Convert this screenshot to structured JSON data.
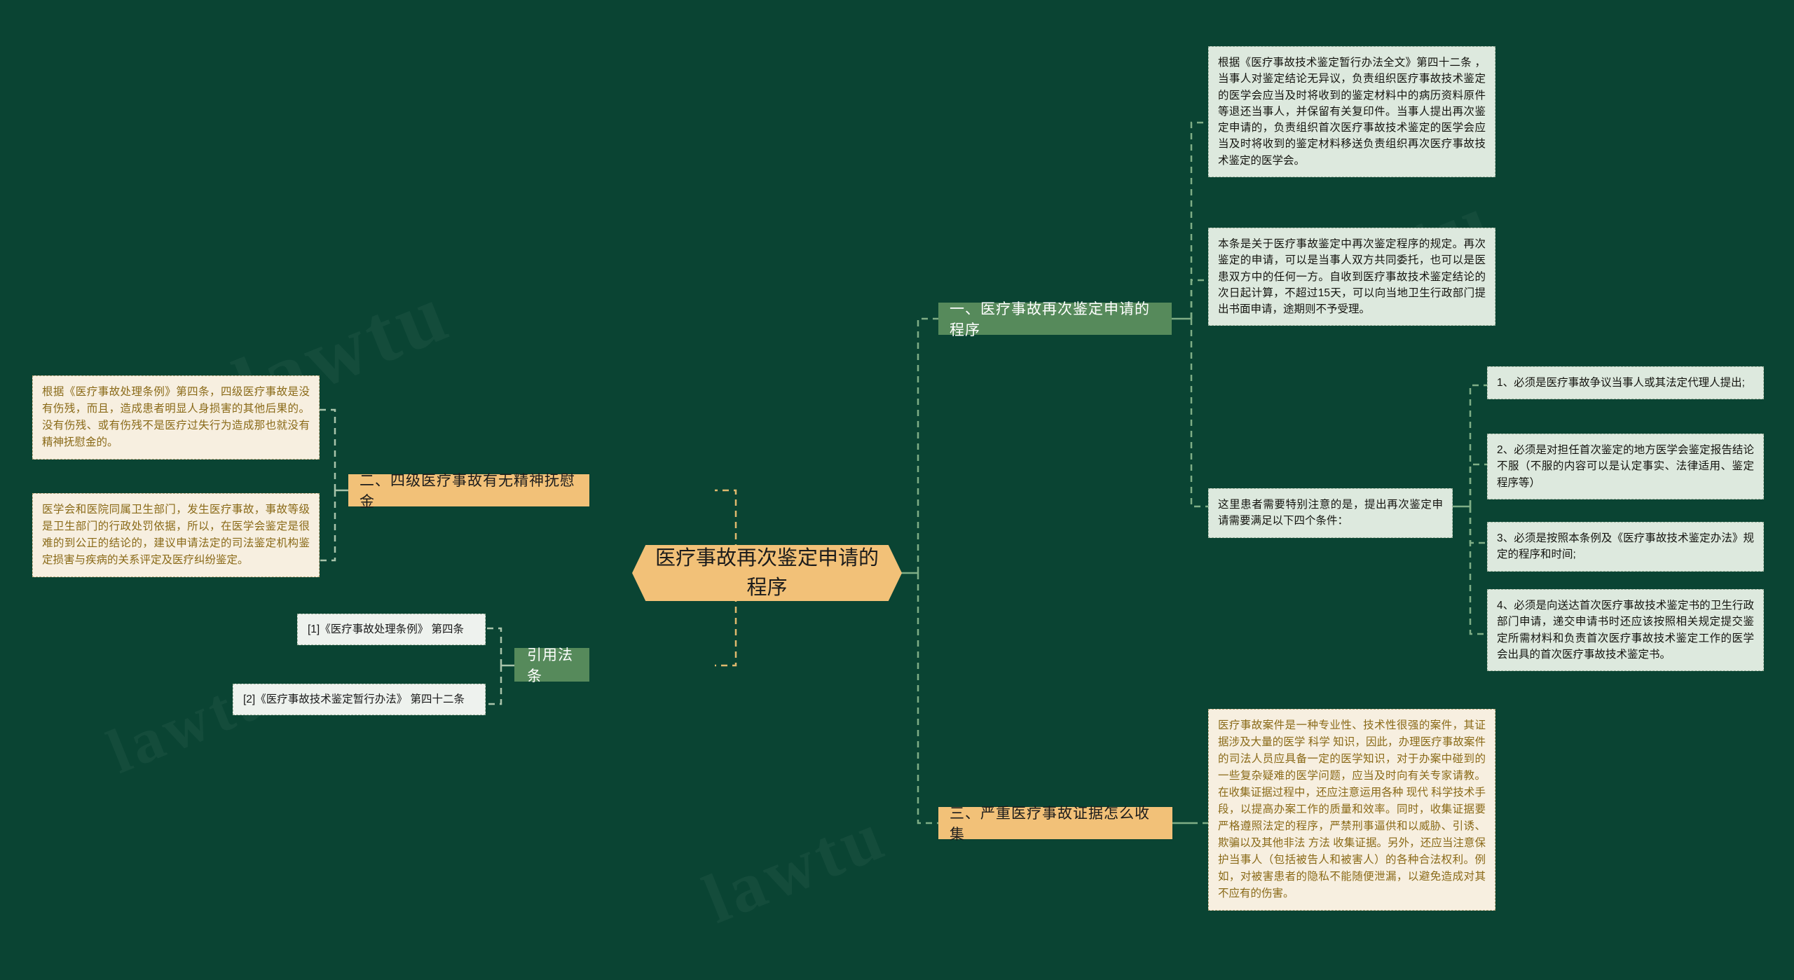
{
  "root": {
    "title": "医疗事故再次鉴定申请的程序"
  },
  "watermarks": {
    "w1": "lawtu",
    "w2": "lawtu",
    "w3": "lawtu",
    "w4": "lawtu"
  },
  "branches": [
    {
      "id": "branch-1",
      "label": "一、医疗事故再次鉴定申请的程序",
      "style": "green",
      "leaves": [
        {
          "id": "leaf-1-1",
          "text": "根据《医疗事故技术鉴定暂行办法全文》第四十二条 ，当事人对鉴定结论无异议，负责组织医疗事故技术鉴定的医学会应当及时将收到的鉴定材料中的病历资料原件等退还当事人，并保留有关复印件。当事人提出再次鉴定申请的，负责组织首次医疗事故技术鉴定的医学会应当及时将收到的鉴定材料移送负责组织再次医疗事故技术鉴定的医学会。"
        },
        {
          "id": "leaf-1-2",
          "text": "本条是关于医疗事故鉴定中再次鉴定程序的规定。再次鉴定的申请，可以是当事人双方共同委托，也可以是医患双方中的任何一方。自收到医疗事故技术鉴定结论的次日起计算，不超过15天，可以向当地卫生行政部门提出书面申请，途期则不予受理。"
        },
        {
          "id": "leaf-1-3",
          "text": "这里患者需要特别注意的是，提出再次鉴定申请需要满足以下四个条件："
        }
      ],
      "conditions": [
        {
          "id": "condition-1",
          "text": "1、必须是医疗事故争议当事人或其法定代理人提出;"
        },
        {
          "id": "condition-2",
          "text": "2、必须是对担任首次鉴定的地方医学会鉴定报告结论不服（不服的内容可以是认定事实、法律适用、鉴定程序等）"
        },
        {
          "id": "condition-3",
          "text": "3、必须是按照本条例及《医疗事故技术鉴定办法》规定的程序和时间;"
        },
        {
          "id": "condition-4",
          "text": "4、必须是向送达首次医疗事故技术鉴定书的卫生行政部门申请，递交申请书时还应该按照相关规定提交鉴定所需材料和负责首次医疗事故技术鉴定工作的医学会出具的首次医疗事故技术鉴定书。"
        }
      ]
    },
    {
      "id": "branch-2",
      "label": "二、四级医疗事故有无精神抚慰金",
      "style": "orange",
      "leaves": [
        {
          "id": "leaf-2-1",
          "text": "根据《医疗事故处理条例》第四条，四级医疗事故是没有伤残，而且，造成患者明显人身损害的其他后果的。没有伤残、或有伤残不是医疗过失行为造成那也就没有精神抚慰金的。"
        },
        {
          "id": "leaf-2-2",
          "text": "医学会和医院同属卫生部门，发生医疗事故，事故等级是卫生部门的行政处罚依据，所以，在医学会鉴定是很难的到公正的结论的，建议申请法定的司法鉴定机构鉴定损害与疾病的关系评定及医疗纠纷鉴定。"
        }
      ]
    },
    {
      "id": "branch-3",
      "label": "引用法条",
      "style": "green-small",
      "leaves": [
        {
          "id": "leaf-3-1",
          "text": "[1]《医疗事故处理条例》 第四条"
        },
        {
          "id": "leaf-3-2",
          "text": "[2]《医疗事故技术鉴定暂行办法》 第四十二条"
        }
      ]
    },
    {
      "id": "branch-4",
      "label": "三、严重医疗事故证据怎么收集",
      "style": "orange",
      "leaves": [
        {
          "id": "leaf-4-1",
          "text": "医疗事故案件是一种专业性、技术性很强的案件，其证据涉及大量的医学 科学 知识，因此，办理医疗事故案件的司法人员应具备一定的医学知识，对于办案中碰到的一些复杂疑难的医学问题，应当及时向有关专家请教。在收集证据过程中，还应注意运用各种 现代 科学技术手段，以提高办案工作的质量和效率。同时，收集证据要严格遵照法定的程序，严禁刑事逼供和以威胁、引诱、欺骗以及其他非法 方法 收集证据。另外，还应当注意保护当事人（包括被告人和被害人）的各种合法权利。例如，对被害患者的隐私不能随便泄漏，以避免造成对其不应有的伤害。"
        }
      ]
    }
  ],
  "colors": {
    "background": "#0a4433",
    "accent_orange": "#f2c178",
    "accent_green": "#568a5b",
    "leaf_mint": "#dde9de",
    "leaf_cream": "#f7efe0",
    "cream_text": "#8a6a18",
    "connector": "#7fae86"
  }
}
